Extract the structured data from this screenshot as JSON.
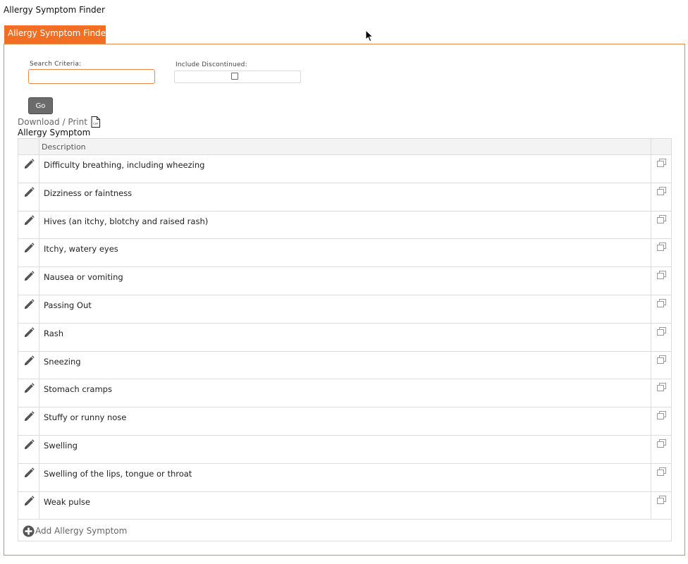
{
  "page": {
    "title": "Allergy Symptom Finder",
    "tab_label": "Allergy Symptom Finder"
  },
  "search": {
    "criteria_label": "Search Criteria:",
    "criteria_value": "",
    "include_discontinued_label": "Include Discontinued:",
    "include_discontinued_checked": false,
    "go_label": "Go"
  },
  "download": {
    "label": "Download / Print",
    "icon": "csv-file-icon"
  },
  "grid": {
    "section_title": "Allergy Symptom",
    "column_description": "Description",
    "rows": [
      {
        "description": "Difficulty breathing, including wheezing"
      },
      {
        "description": "Dizziness or faintness"
      },
      {
        "description": "Hives (an itchy, blotchy and raised rash)"
      },
      {
        "description": "Itchy, watery eyes"
      },
      {
        "description": "Nausea or vomiting"
      },
      {
        "description": "Passing Out"
      },
      {
        "description": "Rash"
      },
      {
        "description": "Sneezing"
      },
      {
        "description": "Stomach cramps"
      },
      {
        "description": "Stuffy or runny nose"
      },
      {
        "description": "Swelling"
      },
      {
        "description": "Swelling of the lips, tongue or throat"
      },
      {
        "description": "Weak pulse"
      }
    ],
    "add_label": "Add Allergy Symptom"
  },
  "colors": {
    "accent": "#f26f21",
    "panel_border": "#e8894a",
    "button_bg": "#6b6b6b"
  }
}
